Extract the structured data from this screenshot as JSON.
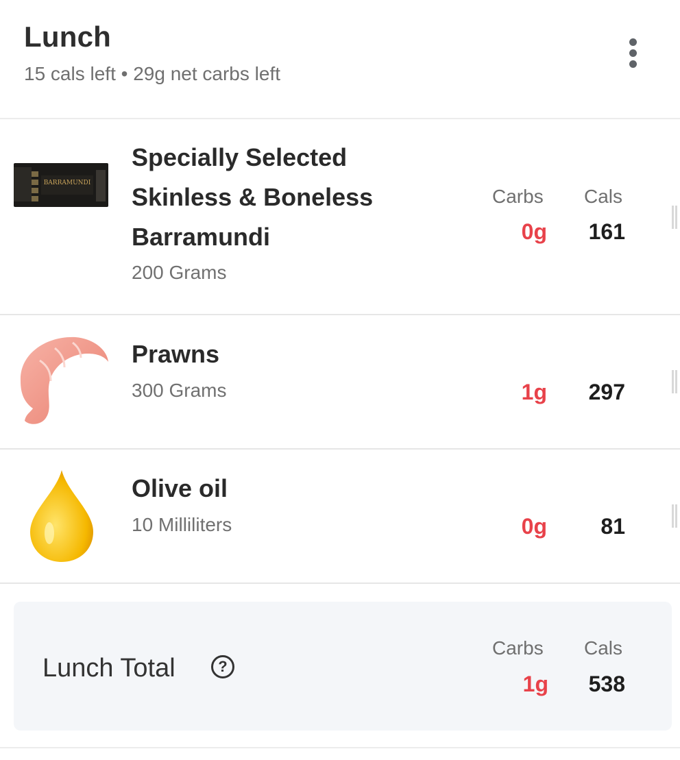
{
  "meal": {
    "title": "Lunch",
    "summary": "15 cals left • 29g net carbs left"
  },
  "columns": {
    "carbs": "Carbs",
    "cals": "Cals"
  },
  "items": [
    {
      "name": "Specially Selected Skinless & Boneless Barramundi",
      "serving": "200 Grams",
      "carbs": "0g",
      "cals": "161",
      "icon": "barramundi-package-icon",
      "package_label": "BARRAMUNDI"
    },
    {
      "name": "Prawns",
      "serving": "300 Grams",
      "carbs": "1g",
      "cals": "297",
      "icon": "prawn-icon"
    },
    {
      "name": "Olive oil",
      "serving": "10 Milliliters",
      "carbs": "0g",
      "cals": "81",
      "icon": "oil-drop-icon"
    }
  ],
  "total": {
    "label": "Lunch Total",
    "help": "?",
    "carbs": "1g",
    "cals": "538"
  },
  "colors": {
    "carbs": "#e8424a",
    "total_bg": "#f4f6f9"
  }
}
